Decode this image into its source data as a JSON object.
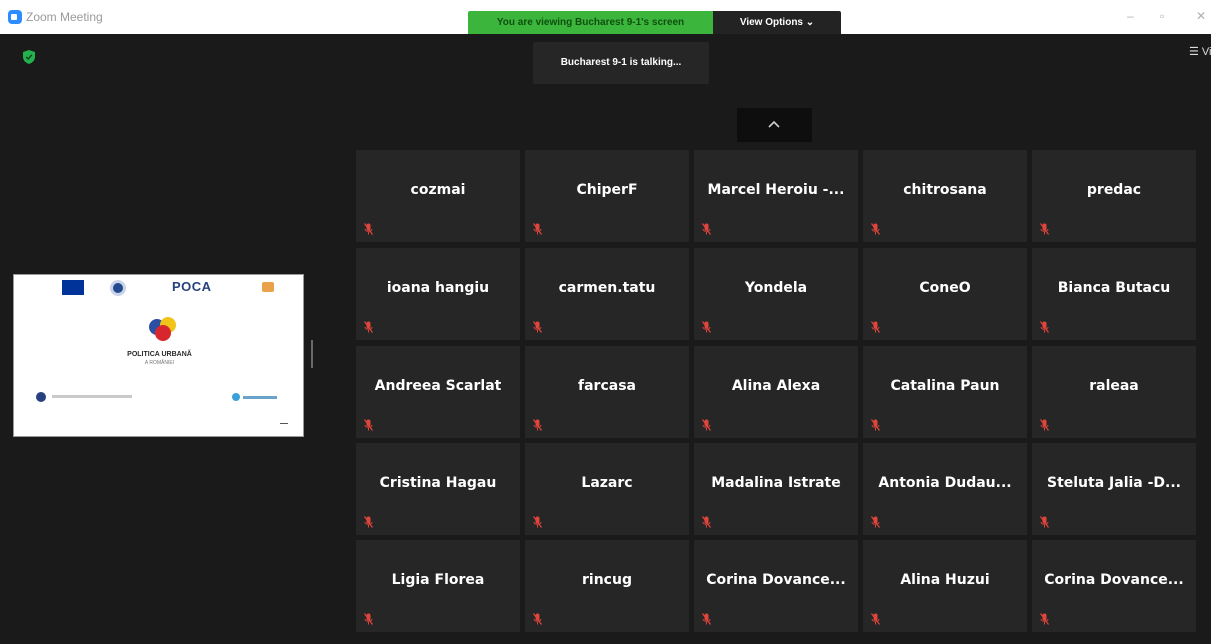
{
  "window": {
    "title": "Zoom Meeting",
    "minimize_glyph": "–",
    "maximize_glyph": "▫",
    "close_glyph": "✕"
  },
  "toolbar": {
    "sharing_banner": "You are viewing Bucharest 9-1's screen",
    "view_options_label": "View Options ⌄"
  },
  "meeting": {
    "talking_indicator": "Bucharest 9-1 is talking...",
    "view_toggle_label": "☰ View"
  },
  "shared_screen": {
    "logo_text": "POCA",
    "title": "POLITICA URBANĂ",
    "subtitle": "A ROMÂNIEI"
  },
  "participants": [
    {
      "name": "cozmai"
    },
    {
      "name": "ChiperF"
    },
    {
      "name": "Marcel Heroiu -..."
    },
    {
      "name": "chitrosana"
    },
    {
      "name": "predac"
    },
    {
      "name": "ioana hangiu"
    },
    {
      "name": "carmen.tatu"
    },
    {
      "name": "Yondela"
    },
    {
      "name": "ConeO"
    },
    {
      "name": "Bianca Butacu"
    },
    {
      "name": "Andreea Scarlat"
    },
    {
      "name": "farcasa"
    },
    {
      "name": "Alina Alexa"
    },
    {
      "name": "Catalina Paun"
    },
    {
      "name": "raleaa"
    },
    {
      "name": "Cristina Hagau"
    },
    {
      "name": "Lazarc"
    },
    {
      "name": "Madalina Istrate"
    },
    {
      "name": "Antonia Dudau..."
    },
    {
      "name": "Steluta Jalia -D..."
    },
    {
      "name": "Ligia Florea"
    },
    {
      "name": "rincug"
    },
    {
      "name": "Corina Dovance..."
    },
    {
      "name": "Alina Huzui"
    },
    {
      "name": "Corina Dovance..."
    }
  ],
  "colors": {
    "banner_green": "#3bb53b",
    "tile_bg": "#262626",
    "mute_red": "#e0453b"
  }
}
